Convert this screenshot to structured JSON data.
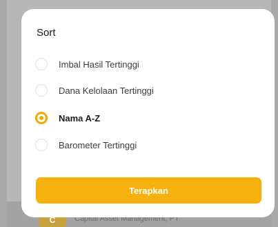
{
  "background": {
    "company_name": "Capital Asset Management, PT"
  },
  "sort_sheet": {
    "title": "Sort",
    "options": [
      {
        "label": "Imbal Hasil Tertinggi",
        "selected": false
      },
      {
        "label": "Dana Kelolaan Tertinggi",
        "selected": false
      },
      {
        "label": "Nama A-Z",
        "selected": true
      },
      {
        "label": "Barometer Tertinggi",
        "selected": false
      }
    ],
    "apply_label": "Terapkan"
  },
  "colors": {
    "accent": "#f5a800",
    "button": "#f7b10f",
    "overlay": "#9b9b9b"
  }
}
